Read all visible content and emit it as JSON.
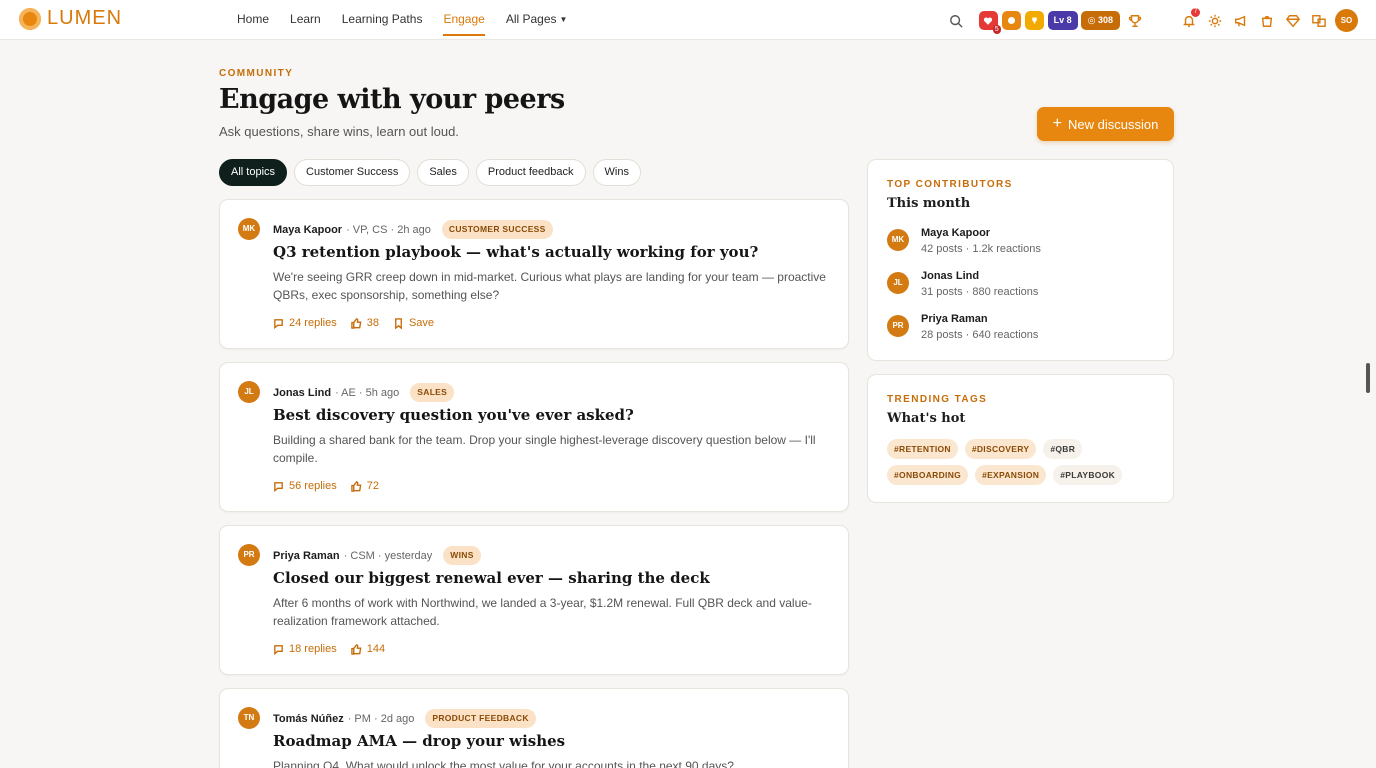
{
  "app": {
    "name": "LUMEN"
  },
  "nav": {
    "items": [
      {
        "label": "Home"
      },
      {
        "label": "Learn"
      },
      {
        "label": "Learning Paths"
      },
      {
        "label": "Engage"
      },
      {
        "label": "All Pages"
      }
    ],
    "active": "Engage"
  },
  "toolbar": {
    "streak_badge": "5",
    "level": "Lv 8",
    "coins": "308",
    "notifications": "7",
    "user_initials": "SO",
    "colors": {
      "heart": "#e53935",
      "accent": "#e8870f",
      "gold": "#f2a900",
      "level": "#4a3aa8",
      "coins": "#c66d0a"
    }
  },
  "header": {
    "eyebrow": "COMMUNITY",
    "title": "Engage with your peers",
    "subtitle": "Ask questions, share wins, learn out loud.",
    "new_button": "New discussion"
  },
  "filters": {
    "chips": [
      "All topics",
      "Customer Success",
      "Sales",
      "Product feedback",
      "Wins"
    ],
    "selected": "All topics"
  },
  "posts": [
    {
      "initials": "MK",
      "author": "Maya Kapoor",
      "role": "· VP, CS · 2h ago",
      "tag": "CUSTOMER SUCCESS",
      "title": "Q3 retention playbook — what's actually working for you?",
      "body": "We're seeing GRR creep down in mid-market. Curious what plays are landing for your team — proactive QBRs, exec sponsorship, something else?",
      "replies": "24 replies",
      "likes": "38",
      "save": "Save"
    },
    {
      "initials": "JL",
      "author": "Jonas Lind",
      "role": "· AE · 5h ago",
      "tag": "SALES",
      "title": "Best discovery question you've ever asked?",
      "body": "Building a shared bank for the team. Drop your single highest-leverage discovery question below — I'll compile.",
      "replies": "56 replies",
      "likes": "72"
    },
    {
      "initials": "PR",
      "author": "Priya Raman",
      "role": "· CSM · yesterday",
      "tag": "WINS",
      "title": "Closed our biggest renewal ever — sharing the deck",
      "body": "After 6 months of work with Northwind, we landed a 3-year, $1.2M renewal. Full QBR deck and value-realization framework attached.",
      "replies": "18 replies",
      "likes": "144"
    },
    {
      "initials": "TN",
      "author": "Tomás Núñez",
      "role": "· PM · 2d ago",
      "tag": "PRODUCT FEEDBACK",
      "title": "Roadmap AMA — drop your wishes",
      "body": "Planning Q4. What would unlock the most value for your accounts in the next 90 days?"
    }
  ],
  "sidebar": {
    "contributors": {
      "eyebrow": "TOP CONTRIBUTORS",
      "title": "This month",
      "people": [
        {
          "initials": "MK",
          "name": "Maya Kapoor",
          "stats": "42 posts · 1.2k reactions"
        },
        {
          "initials": "JL",
          "name": "Jonas Lind",
          "stats": "31 posts · 880 reactions"
        },
        {
          "initials": "PR",
          "name": "Priya Raman",
          "stats": "28 posts · 640 reactions"
        }
      ]
    },
    "trending": {
      "eyebrow": "TRENDING TAGS",
      "title": "What's hot",
      "tags": [
        "#RETENTION",
        "#DISCOVERY",
        "#QBR",
        "#ONBOARDING",
        "#EXPANSION",
        "#PLAYBOOK"
      ]
    }
  }
}
